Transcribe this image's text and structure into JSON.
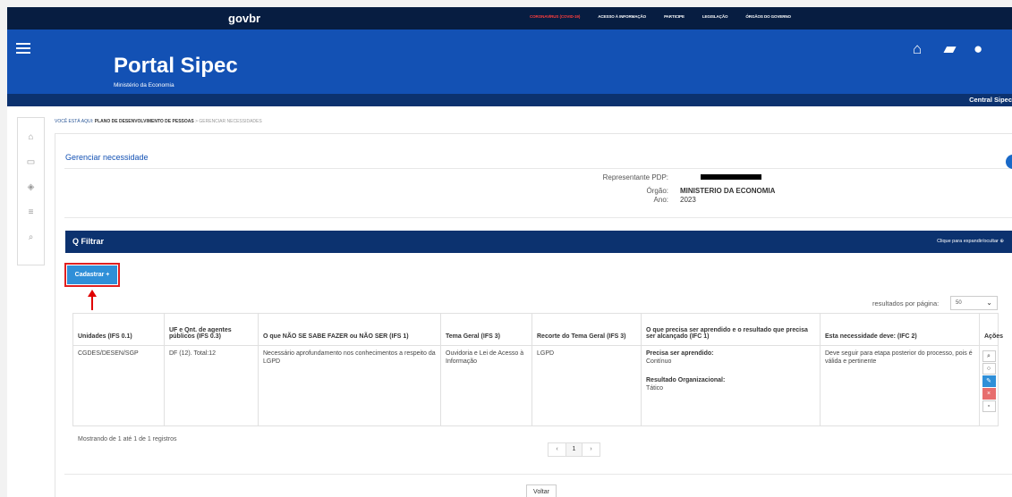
{
  "topbar": {
    "logo": "govbr",
    "links": [
      "CORONAVÍRUS (COVID-19)",
      "ACESSO À INFORMAÇÃO",
      "PARTICIPE",
      "LEGISLAÇÃO",
      "ÓRGÃOS DO GOVERNO"
    ]
  },
  "header": {
    "title": "Portal Sipec",
    "subtitle": "Ministério da Economia",
    "subbar": "Central Sipec"
  },
  "breadcrumb": {
    "prefix": "VOCÊ ESTÁ AQUI:",
    "item": "PLANO DE DESENVOLVIMENTO DE PESSOAS",
    "sep": " > ",
    "current": "GERENCIAR NECESSIDADES"
  },
  "page": {
    "title": "Gerenciar necessidade"
  },
  "info": {
    "rep_label": "Representante PDP:",
    "org_label": "Órgão:",
    "org_value": "MINISTERIO DA ECONOMIA",
    "year_label": "Ano:",
    "year_value": "2023"
  },
  "filter": {
    "title": "Q Filtrar",
    "toggle": "Clique para expandir/ocultar ⊕"
  },
  "cadastrar_label": "Cadastrar +",
  "results": {
    "label": "resultados por página:",
    "value": "50"
  },
  "table": {
    "headers": [
      "Unidades (IFS 0.1)",
      "UF e Qnt. de agentes públicos (IFS 0.3)",
      "O que NÃO SE SABE FAZER ou NÃO SER (IFS 1)",
      "Tema Geral (IFS 3)",
      "Recorte do Tema Geral (IFS 3)",
      "O que precisa ser aprendido e o resultado que precisa ser alcançado (IFC 1)",
      "Esta necessidade deve: (IFC 2)",
      "Ações"
    ],
    "row": {
      "unidade": "CGDES/DESEN/SGP",
      "uf": "DF (12). Total:12",
      "nao_sabe": "Necessário aprofundamento nos conhecimentos a respeito da LGPD",
      "tema": "Ouvidoria e Lei de Acesso à Informação",
      "recorte": "LGPD",
      "aprender_label": "Precisa ser aprendido:",
      "aprender_value": "Contínuo",
      "resultado_label": "Resultado Organizacional:",
      "resultado_value": "Tático",
      "deve": "Deve seguir para etapa posterior do processo, pois é válida e pertinente"
    }
  },
  "footer": {
    "showing": "Mostrando de 1 até 1 de 1 registros",
    "prev": "‹",
    "page": "1",
    "next": "›",
    "back": "Voltar"
  }
}
